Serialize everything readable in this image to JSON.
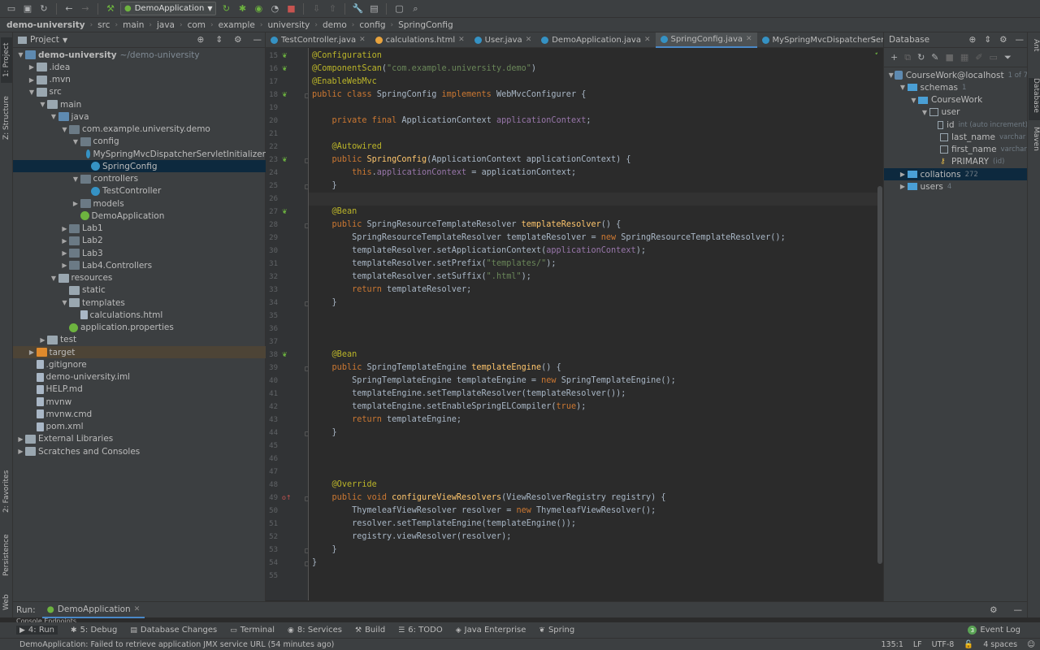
{
  "toolbar": {
    "run_config": "DemoApplication"
  },
  "breadcrumbs": [
    "demo-university",
    "src",
    "main",
    "java",
    "com",
    "example",
    "university",
    "demo",
    "config",
    "SpringConfig"
  ],
  "left_stripe": {
    "project": "1: Project",
    "structure": "Z: Structure",
    "favorites": "2: Favorites",
    "persistence": "Persistence",
    "web": "Web"
  },
  "project_panel": {
    "title": "Project",
    "tree": [
      {
        "label": "demo-university",
        "suffix": "~/demo-university",
        "depth": 0,
        "arrow": "▼",
        "icon": "module",
        "bold": true
      },
      {
        "label": ".idea",
        "depth": 1,
        "arrow": "▶",
        "icon": "folder"
      },
      {
        "label": ".mvn",
        "depth": 1,
        "arrow": "▶",
        "icon": "folder"
      },
      {
        "label": "src",
        "depth": 1,
        "arrow": "▼",
        "icon": "folder"
      },
      {
        "label": "main",
        "depth": 2,
        "arrow": "▼",
        "icon": "folder"
      },
      {
        "label": "java",
        "depth": 3,
        "arrow": "▼",
        "icon": "module"
      },
      {
        "label": "com.example.university.demo",
        "depth": 4,
        "arrow": "▼",
        "icon": "pkg"
      },
      {
        "label": "config",
        "depth": 5,
        "arrow": "▼",
        "icon": "pkg"
      },
      {
        "label": "MySpringMvcDispatcherServletInitializer",
        "depth": 6,
        "arrow": "",
        "icon": "class"
      },
      {
        "label": "SpringConfig",
        "depth": 6,
        "arrow": "",
        "icon": "class",
        "selected": true
      },
      {
        "label": "controllers",
        "depth": 5,
        "arrow": "▼",
        "icon": "pkg"
      },
      {
        "label": "TestController",
        "depth": 6,
        "arrow": "",
        "icon": "class"
      },
      {
        "label": "models",
        "depth": 5,
        "arrow": "▶",
        "icon": "pkg"
      },
      {
        "label": "DemoApplication",
        "depth": 5,
        "arrow": "",
        "icon": "spring"
      },
      {
        "label": "Lab1",
        "depth": 4,
        "arrow": "▶",
        "icon": "pkg"
      },
      {
        "label": "Lab2",
        "depth": 4,
        "arrow": "▶",
        "icon": "pkg"
      },
      {
        "label": "Lab3",
        "depth": 4,
        "arrow": "▶",
        "icon": "pkg"
      },
      {
        "label": "Lab4.Controllers",
        "depth": 4,
        "arrow": "▶",
        "icon": "pkg"
      },
      {
        "label": "resources",
        "depth": 3,
        "arrow": "▼",
        "icon": "folder"
      },
      {
        "label": "static",
        "depth": 4,
        "arrow": "",
        "icon": "folder"
      },
      {
        "label": "templates",
        "depth": 4,
        "arrow": "▼",
        "icon": "folder"
      },
      {
        "label": "calculations.html",
        "depth": 5,
        "arrow": "",
        "icon": "file"
      },
      {
        "label": "application.properties",
        "depth": 4,
        "arrow": "",
        "icon": "spring"
      },
      {
        "label": "test",
        "depth": 2,
        "arrow": "▶",
        "icon": "folder"
      },
      {
        "label": "target",
        "depth": 1,
        "arrow": "▶",
        "icon": "excl",
        "excluded": true
      },
      {
        "label": ".gitignore",
        "depth": 1,
        "arrow": "",
        "icon": "file"
      },
      {
        "label": "demo-university.iml",
        "depth": 1,
        "arrow": "",
        "icon": "file"
      },
      {
        "label": "HELP.md",
        "depth": 1,
        "arrow": "",
        "icon": "file"
      },
      {
        "label": "mvnw",
        "depth": 1,
        "arrow": "",
        "icon": "file"
      },
      {
        "label": "mvnw.cmd",
        "depth": 1,
        "arrow": "",
        "icon": "file"
      },
      {
        "label": "pom.xml",
        "depth": 1,
        "arrow": "",
        "icon": "file"
      },
      {
        "label": "External Libraries",
        "depth": 0,
        "arrow": "▶",
        "icon": "lib"
      },
      {
        "label": "Scratches and Consoles",
        "depth": 0,
        "arrow": "▶",
        "icon": "lib"
      }
    ]
  },
  "editor_tabs": [
    {
      "label": "TestController.java",
      "active": false
    },
    {
      "label": "calculations.html",
      "active": false
    },
    {
      "label": "User.java",
      "active": false
    },
    {
      "label": "DemoApplication.java",
      "active": false
    },
    {
      "label": "SpringConfig.java",
      "active": true
    },
    {
      "label": "MySpringMvcDispatcherServletInitializer.java",
      "active": false
    }
  ],
  "code": {
    "first_line": 15,
    "current_line": 26,
    "lines": [
      [
        [
          "an",
          "@Configuration"
        ]
      ],
      [
        [
          "an",
          "@ComponentScan"
        ],
        [
          "t",
          "("
        ],
        [
          "str",
          "\"com.example.university.demo\""
        ],
        [
          "t",
          ")"
        ]
      ],
      [
        [
          "an",
          "@EnableWebMvc"
        ]
      ],
      [
        [
          "kw",
          "public class "
        ],
        [
          "t",
          "SpringConfig "
        ],
        [
          "kw",
          "implements "
        ],
        [
          "t",
          "WebMvcConfigurer {"
        ]
      ],
      [],
      [
        [
          "t",
          "    "
        ],
        [
          "kw",
          "private final "
        ],
        [
          "t",
          "ApplicationContext "
        ],
        [
          "fld",
          "applicationContext"
        ],
        [
          "t",
          ";"
        ]
      ],
      [],
      [
        [
          "t",
          "    "
        ],
        [
          "an",
          "@Autowired"
        ]
      ],
      [
        [
          "t",
          "    "
        ],
        [
          "kw",
          "public "
        ],
        [
          "fn",
          "SpringConfig"
        ],
        [
          "t",
          "(ApplicationContext applicationContext) {"
        ]
      ],
      [
        [
          "t",
          "        "
        ],
        [
          "kw",
          "this"
        ],
        [
          "t",
          "."
        ],
        [
          "fld",
          "applicationContext"
        ],
        [
          "t",
          " = applicationContext;"
        ]
      ],
      [
        [
          "t",
          "    }"
        ]
      ],
      [],
      [
        [
          "t",
          "    "
        ],
        [
          "an",
          "@Bean"
        ]
      ],
      [
        [
          "t",
          "    "
        ],
        [
          "kw",
          "public "
        ],
        [
          "t",
          "SpringResourceTemplateResolver "
        ],
        [
          "fn",
          "templateResolver"
        ],
        [
          "t",
          "() {"
        ]
      ],
      [
        [
          "t",
          "        SpringResourceTemplateResolver templateResolver = "
        ],
        [
          "kw",
          "new "
        ],
        [
          "t",
          "SpringResourceTemplateResolver();"
        ]
      ],
      [
        [
          "t",
          "        templateResolver.setApplicationContext("
        ],
        [
          "fld",
          "applicationContext"
        ],
        [
          "t",
          ");"
        ]
      ],
      [
        [
          "t",
          "        templateResolver.setPrefix("
        ],
        [
          "str",
          "\"templates/\""
        ],
        [
          "t",
          ");"
        ]
      ],
      [
        [
          "t",
          "        templateResolver.setSuffix("
        ],
        [
          "str",
          "\".html\""
        ],
        [
          "t",
          ");"
        ]
      ],
      [
        [
          "t",
          "        "
        ],
        [
          "kw",
          "return "
        ],
        [
          "t",
          "templateResolver;"
        ]
      ],
      [
        [
          "t",
          "    }"
        ]
      ],
      [],
      [],
      [],
      [
        [
          "t",
          "    "
        ],
        [
          "an",
          "@Bean"
        ]
      ],
      [
        [
          "t",
          "    "
        ],
        [
          "kw",
          "public "
        ],
        [
          "t",
          "SpringTemplateEngine "
        ],
        [
          "fn",
          "templateEngine"
        ],
        [
          "t",
          "() {"
        ]
      ],
      [
        [
          "t",
          "        SpringTemplateEngine templateEngine = "
        ],
        [
          "kw",
          "new "
        ],
        [
          "t",
          "SpringTemplateEngine();"
        ]
      ],
      [
        [
          "t",
          "        templateEngine.setTemplateResolver(templateResolver());"
        ]
      ],
      [
        [
          "t",
          "        templateEngine.setEnableSpringELCompiler("
        ],
        [
          "kw",
          "true"
        ],
        [
          "t",
          ");"
        ]
      ],
      [
        [
          "t",
          "        "
        ],
        [
          "kw",
          "return "
        ],
        [
          "t",
          "templateEngine;"
        ]
      ],
      [
        [
          "t",
          "    }"
        ]
      ],
      [],
      [],
      [],
      [
        [
          "t",
          "    "
        ],
        [
          "an",
          "@Override"
        ]
      ],
      [
        [
          "t",
          "    "
        ],
        [
          "kw",
          "public void "
        ],
        [
          "fn",
          "configureViewResolvers"
        ],
        [
          "t",
          "(ViewResolverRegistry registry) {"
        ]
      ],
      [
        [
          "t",
          "        ThymeleafViewResolver resolver = "
        ],
        [
          "kw",
          "new "
        ],
        [
          "t",
          "ThymeleafViewResolver();"
        ]
      ],
      [
        [
          "t",
          "        resolver.setTemplateEngine(templateEngine());"
        ]
      ],
      [
        [
          "t",
          "        registry.viewResolver(resolver);"
        ]
      ],
      [
        [
          "t",
          "    }"
        ]
      ],
      [
        [
          "t",
          "}"
        ]
      ],
      []
    ]
  },
  "database_panel": {
    "title": "Database",
    "tree": [
      {
        "label": "CourseWork@localhost",
        "tag": "1 of 7",
        "depth": 0,
        "arrow": "▼",
        "icon": "db"
      },
      {
        "label": "schemas",
        "tag": "1",
        "depth": 1,
        "arrow": "▼",
        "icon": "schema"
      },
      {
        "label": "CourseWork",
        "tag": "",
        "depth": 2,
        "arrow": "▼",
        "icon": "schema"
      },
      {
        "label": "user",
        "tag": "",
        "depth": 3,
        "arrow": "▼",
        "icon": "table"
      },
      {
        "label": "id",
        "tag": "int (auto increment)",
        "depth": 4,
        "arrow": "",
        "icon": "col"
      },
      {
        "label": "last_name",
        "tag": "varchar",
        "depth": 4,
        "arrow": "",
        "icon": "col"
      },
      {
        "label": "first_name",
        "tag": "varchar",
        "depth": 4,
        "arrow": "",
        "icon": "col"
      },
      {
        "label": "PRIMARY",
        "tag": "(id)",
        "depth": 4,
        "arrow": "",
        "icon": "key"
      },
      {
        "label": "collations",
        "tag": "272",
        "depth": 1,
        "arrow": "▶",
        "icon": "schema",
        "selected": true
      },
      {
        "label": "users",
        "tag": "4",
        "depth": 1,
        "arrow": "▶",
        "icon": "schema"
      }
    ]
  },
  "right_stripe": {
    "ant": "Ant",
    "database": "Database",
    "maven": "Maven"
  },
  "run_bar": {
    "label": "Run:",
    "tab": "DemoApplication",
    "sub_tabs": "Console  Endpoints"
  },
  "tool_windows": [
    {
      "label": "4: Run",
      "active": true
    },
    {
      "label": "5: Debug"
    },
    {
      "label": "Database Changes"
    },
    {
      "label": "Terminal"
    },
    {
      "label": "8: Services"
    },
    {
      "label": "Build"
    },
    {
      "label": "6: TODO"
    },
    {
      "label": "Java Enterprise"
    },
    {
      "label": "Spring"
    }
  ],
  "event_log": {
    "label": "Event Log",
    "count": "3"
  },
  "status": {
    "message": "DemoApplication: Failed to retrieve application JMX service URL (54 minutes ago)",
    "position": "135:1",
    "line_sep": "LF",
    "encoding": "UTF-8",
    "indent": "4 spaces"
  }
}
